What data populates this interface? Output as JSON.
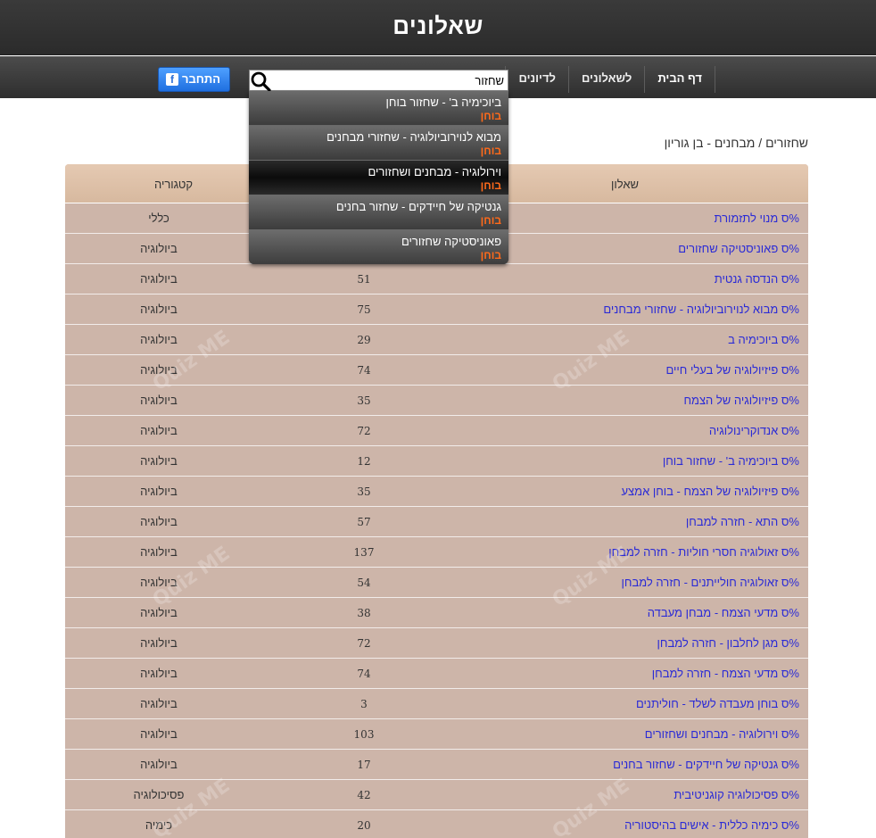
{
  "site": {
    "title": "שאלונים"
  },
  "nav": {
    "items": [
      {
        "label": "דף הבית"
      },
      {
        "label": "לשאלונים"
      },
      {
        "label": "לדיונים"
      }
    ]
  },
  "search": {
    "value": "שחזור",
    "icon": "search-icon"
  },
  "login": {
    "label": "התחבר",
    "icon": "facebook-icon",
    "icon_glyph": "f",
    "color": "#2b6fd6"
  },
  "breadcrumb": "שחזורים / מבחנים - בן גוריון",
  "dropdown": {
    "items": [
      {
        "title": "ביוכימיה ב' - שחזור בוחן",
        "type": "בוחן"
      },
      {
        "title": "מבוא לנוירוביולוגיה - שחזורי מבחנים",
        "type": "בוחן"
      },
      {
        "title": "וירולוגיה - מבחנים ושחזורים",
        "type": "בוחן"
      },
      {
        "title": "גנטיקה של חיידקים - שחזור בחנים",
        "type": "בוחן"
      },
      {
        "title": "פאוניסטיקה שחזורים",
        "type": "בוחן"
      }
    ],
    "accent": "#ff6a1a"
  },
  "table": {
    "headers": {
      "quiz": "שאלון",
      "category": "קטגוריה"
    },
    "watermark": "Quiz ME",
    "rows": [
      {
        "title": "מנוי לתזמורת",
        "count": "",
        "category": "כללי"
      },
      {
        "title": "פאוניסטיקה שחזורים",
        "count": "",
        "category": "ביולוגיה"
      },
      {
        "title": "הנדסה גנטית",
        "count": "51",
        "category": "ביולוגיה"
      },
      {
        "title": "מבוא לנוירוביולוגיה - שחזורי מבחנים",
        "count": "75",
        "category": "ביולוגיה"
      },
      {
        "title": "ביוכימיה ב",
        "count": "29",
        "category": "ביולוגיה"
      },
      {
        "title": "פיזיולוגיה של בעלי חיים",
        "count": "74",
        "category": "ביולוגיה"
      },
      {
        "title": "פיזיולוגיה של הצמח",
        "count": "35",
        "category": "ביולוגיה"
      },
      {
        "title": "אנדוקרינולוגיה",
        "count": "72",
        "category": "ביולוגיה"
      },
      {
        "title": "ביוכימיה ב' - שחזור בוחן",
        "count": "12",
        "category": "ביולוגיה"
      },
      {
        "title": "פיזיולוגיה של הצמח - בוחן אמצע",
        "count": "35",
        "category": "ביולוגיה"
      },
      {
        "title": "התא - חזרה למבחן",
        "count": "57",
        "category": "ביולוגיה"
      },
      {
        "title": "זאולוגיה חסרי חוליות - חזרה למבחן",
        "count": "137",
        "category": "ביולוגיה"
      },
      {
        "title": "זאולוגיה חולייתנים - חזרה למבחן",
        "count": "54",
        "category": "ביולוגיה"
      },
      {
        "title": "מדעי הצמח - מבחן מעבדה",
        "count": "38",
        "category": "ביולוגיה"
      },
      {
        "title": "מגן לחלבון - חזרה למבחן",
        "count": "72",
        "category": "ביולוגיה"
      },
      {
        "title": "מדעי הצמח - חזרה למבחן",
        "count": "74",
        "category": "ביולוגיה"
      },
      {
        "title": "בוחן מעבדה לשלד - חוליתנים",
        "count": "3",
        "category": "ביולוגיה"
      },
      {
        "title": "וירולוגיה - מבחנים ושחזורים",
        "count": "103",
        "category": "ביולוגיה"
      },
      {
        "title": "גנטיקה של חיידקים - שחזור בחנים",
        "count": "17",
        "category": "ביולוגיה"
      },
      {
        "title": "פסיכולוגיה קוגניטיבית",
        "count": "42",
        "category": "פסיכולוגיה"
      },
      {
        "title": "כימיה כללית - אישים בהיסטוריה",
        "count": "20",
        "category": "כימיה"
      }
    ],
    "row_prefix": "%ס"
  },
  "colors": {
    "header_bg": "#2b2b2b",
    "table_bg": "#cdb5a9",
    "link": "#2b2bd6",
    "fb_blue": "#1f6fe0"
  }
}
